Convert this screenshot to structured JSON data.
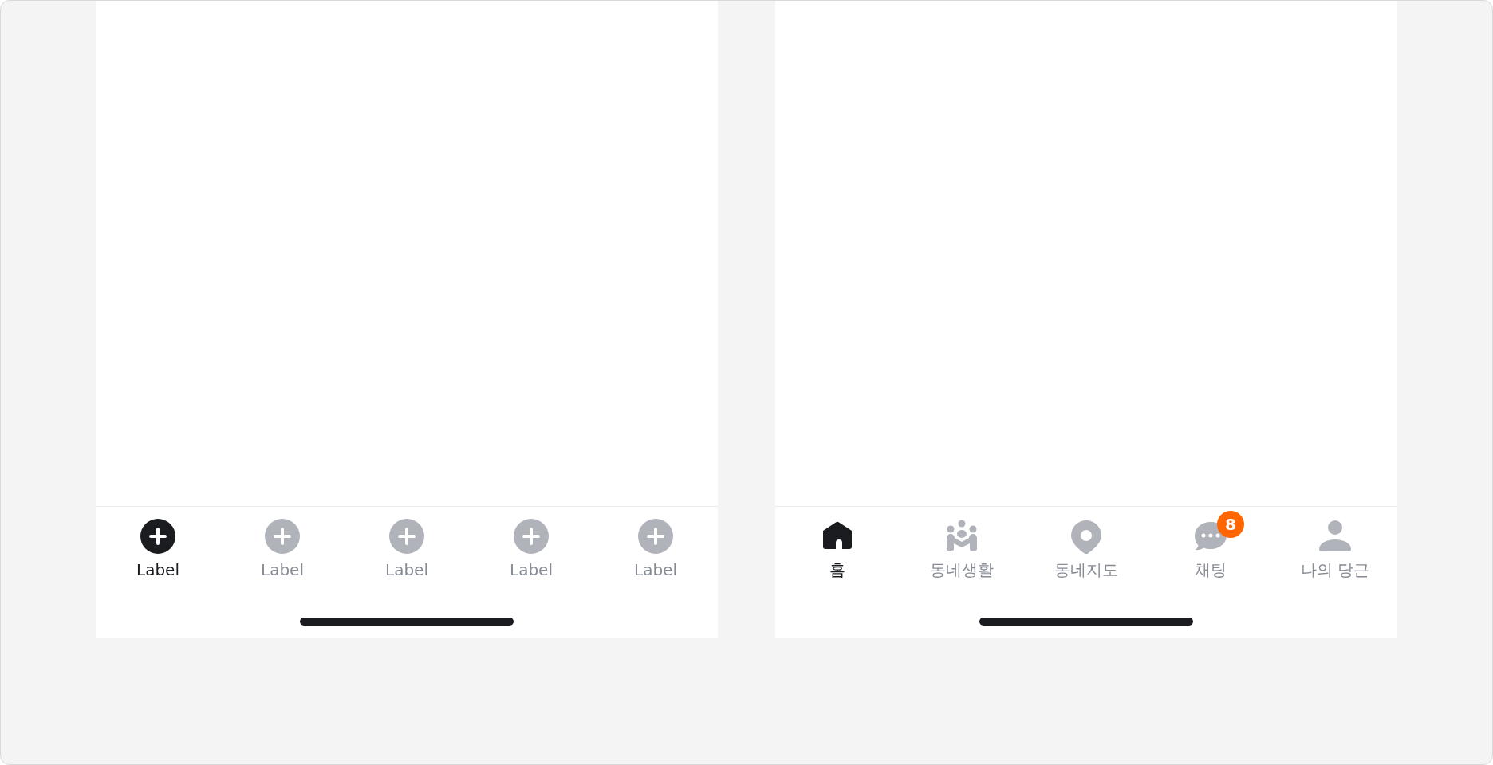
{
  "screens": [
    {
      "tabs": [
        {
          "label": "Label",
          "kind": "plus",
          "selected": true
        },
        {
          "label": "Label",
          "kind": "plus",
          "selected": false
        },
        {
          "label": "Label",
          "kind": "plus",
          "selected": false
        },
        {
          "label": "Label",
          "kind": "plus",
          "selected": false
        },
        {
          "label": "Label",
          "kind": "plus",
          "selected": false
        }
      ]
    },
    {
      "tabs": [
        {
          "label": "홈",
          "kind": "home",
          "selected": true
        },
        {
          "label": "동네생활",
          "kind": "community",
          "selected": false
        },
        {
          "label": "동네지도",
          "kind": "pin",
          "selected": false
        },
        {
          "label": "채팅",
          "kind": "chat",
          "selected": false,
          "badge": "8"
        },
        {
          "label": "나의 당근",
          "kind": "person",
          "selected": false
        }
      ]
    }
  ]
}
